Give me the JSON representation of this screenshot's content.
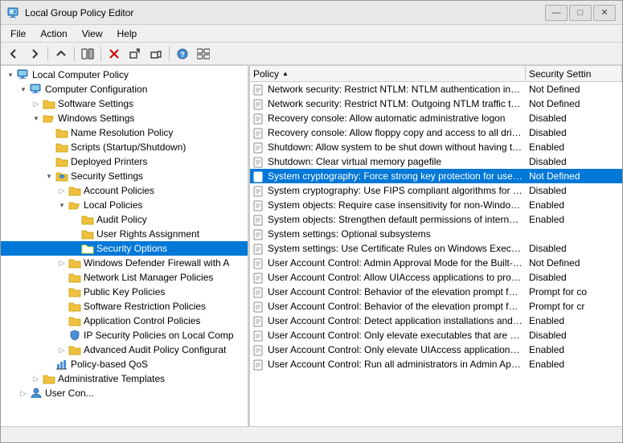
{
  "window": {
    "title": "Local Group Policy Editor",
    "controls": {
      "minimize": "—",
      "maximize": "□",
      "close": "✕"
    }
  },
  "menu": {
    "items": [
      "File",
      "Action",
      "View",
      "Help"
    ]
  },
  "toolbar": {
    "buttons": [
      "◀",
      "▶",
      "⬆",
      "📋",
      "🗑",
      "↔",
      "📄",
      "🔍"
    ]
  },
  "tree": {
    "items": [
      {
        "id": "local-computer-policy",
        "label": "Local Computer Policy",
        "level": 0,
        "expand": "▾",
        "icon": "computer",
        "expanded": true
      },
      {
        "id": "computer-configuration",
        "label": "Computer Configuration",
        "level": 1,
        "expand": "▾",
        "icon": "computer",
        "expanded": true
      },
      {
        "id": "software-settings",
        "label": "Software Settings",
        "level": 2,
        "expand": "▷",
        "icon": "folder"
      },
      {
        "id": "windows-settings",
        "label": "Windows Settings",
        "level": 2,
        "expand": "▾",
        "icon": "folder-open",
        "expanded": true
      },
      {
        "id": "name-resolution-policy",
        "label": "Name Resolution Policy",
        "level": 3,
        "expand": " ",
        "icon": "folder"
      },
      {
        "id": "scripts",
        "label": "Scripts (Startup/Shutdown)",
        "level": 3,
        "expand": " ",
        "icon": "folder"
      },
      {
        "id": "deployed-printers",
        "label": "Deployed Printers",
        "level": 3,
        "expand": " ",
        "icon": "folder"
      },
      {
        "id": "security-settings",
        "label": "Security Settings",
        "level": 3,
        "expand": "▾",
        "icon": "folder-open",
        "expanded": true
      },
      {
        "id": "account-policies",
        "label": "Account Policies",
        "level": 4,
        "expand": "▷",
        "icon": "folder"
      },
      {
        "id": "local-policies",
        "label": "Local Policies",
        "level": 4,
        "expand": "▾",
        "icon": "folder-open",
        "expanded": true
      },
      {
        "id": "audit-policy",
        "label": "Audit Policy",
        "level": 5,
        "expand": " ",
        "icon": "folder"
      },
      {
        "id": "user-rights-assignment",
        "label": "User Rights Assignment",
        "level": 5,
        "expand": " ",
        "icon": "folder"
      },
      {
        "id": "security-options",
        "label": "Security Options",
        "level": 5,
        "expand": " ",
        "icon": "folder",
        "selected": true
      },
      {
        "id": "windows-defender-firewall",
        "label": "Windows Defender Firewall with A",
        "level": 4,
        "expand": "▷",
        "icon": "folder"
      },
      {
        "id": "network-list-manager",
        "label": "Network List Manager Policies",
        "level": 4,
        "expand": " ",
        "icon": "folder"
      },
      {
        "id": "public-key-policies",
        "label": "Public Key Policies",
        "level": 4,
        "expand": " ",
        "icon": "folder"
      },
      {
        "id": "software-restriction-policies",
        "label": "Software Restriction Policies",
        "level": 4,
        "expand": " ",
        "icon": "folder"
      },
      {
        "id": "application-control",
        "label": "Application Control Policies",
        "level": 4,
        "expand": " ",
        "icon": "folder"
      },
      {
        "id": "ip-security-policies",
        "label": "IP Security Policies on Local Comp",
        "level": 4,
        "expand": " ",
        "icon": "shield"
      },
      {
        "id": "advanced-audit",
        "label": "Advanced Audit Policy Configurat",
        "level": 4,
        "expand": "▷",
        "icon": "folder"
      },
      {
        "id": "policy-based-qos",
        "label": "Policy-based QoS",
        "level": 3,
        "expand": " ",
        "icon": "chart"
      },
      {
        "id": "administrative-templates",
        "label": "Administrative Templates",
        "level": 2,
        "expand": "▷",
        "icon": "folder"
      }
    ]
  },
  "policy_header": {
    "col1": "Policy",
    "col2": "Security Settin",
    "sort_indicator": "▲"
  },
  "policies": [
    {
      "name": "Network security: Restrict NTLM: NTLM authentication in thi...",
      "value": "Not Defined"
    },
    {
      "name": "Network security: Restrict NTLM: Outgoing NTLM traffic to r...",
      "value": "Not Defined"
    },
    {
      "name": "Recovery console: Allow automatic administrative logon",
      "value": "Disabled"
    },
    {
      "name": "Recovery console: Allow floppy copy and access to all drives...",
      "value": "Disabled"
    },
    {
      "name": "Shutdown: Allow system to be shut down without having to...",
      "value": "Enabled"
    },
    {
      "name": "Shutdown: Clear virtual memory pagefile",
      "value": "Disabled"
    },
    {
      "name": "System cryptography: Force strong key protection for user k...",
      "value": "Not Defined",
      "selected": true
    },
    {
      "name": "System cryptography: Use FIPS compliant algorithms for en...",
      "value": "Disabled"
    },
    {
      "name": "System objects: Require case insensitivity for non-Windows ...",
      "value": "Enabled"
    },
    {
      "name": "System objects: Strengthen default permissions of internal s...",
      "value": "Enabled"
    },
    {
      "name": "System settings: Optional subsystems",
      "value": ""
    },
    {
      "name": "System settings: Use Certificate Rules on Windows Executab...",
      "value": "Disabled"
    },
    {
      "name": "User Account Control: Admin Approval Mode for the Built-i...",
      "value": "Not Defined"
    },
    {
      "name": "User Account Control: Allow UIAccess applications to prom...",
      "value": "Disabled"
    },
    {
      "name": "User Account Control: Behavior of the elevation prompt for ...",
      "value": "Prompt for co"
    },
    {
      "name": "User Account Control: Behavior of the elevation prompt for ...",
      "value": "Prompt for cr"
    },
    {
      "name": "User Account Control: Detect application installations and p...",
      "value": "Enabled"
    },
    {
      "name": "User Account Control: Only elevate executables that are sig...",
      "value": "Disabled"
    },
    {
      "name": "User Account Control: Only elevate UIAccess applications th...",
      "value": "Enabled"
    },
    {
      "name": "User Account Control: Run all administrators in Admin Appr...",
      "value": "Enabled"
    }
  ]
}
